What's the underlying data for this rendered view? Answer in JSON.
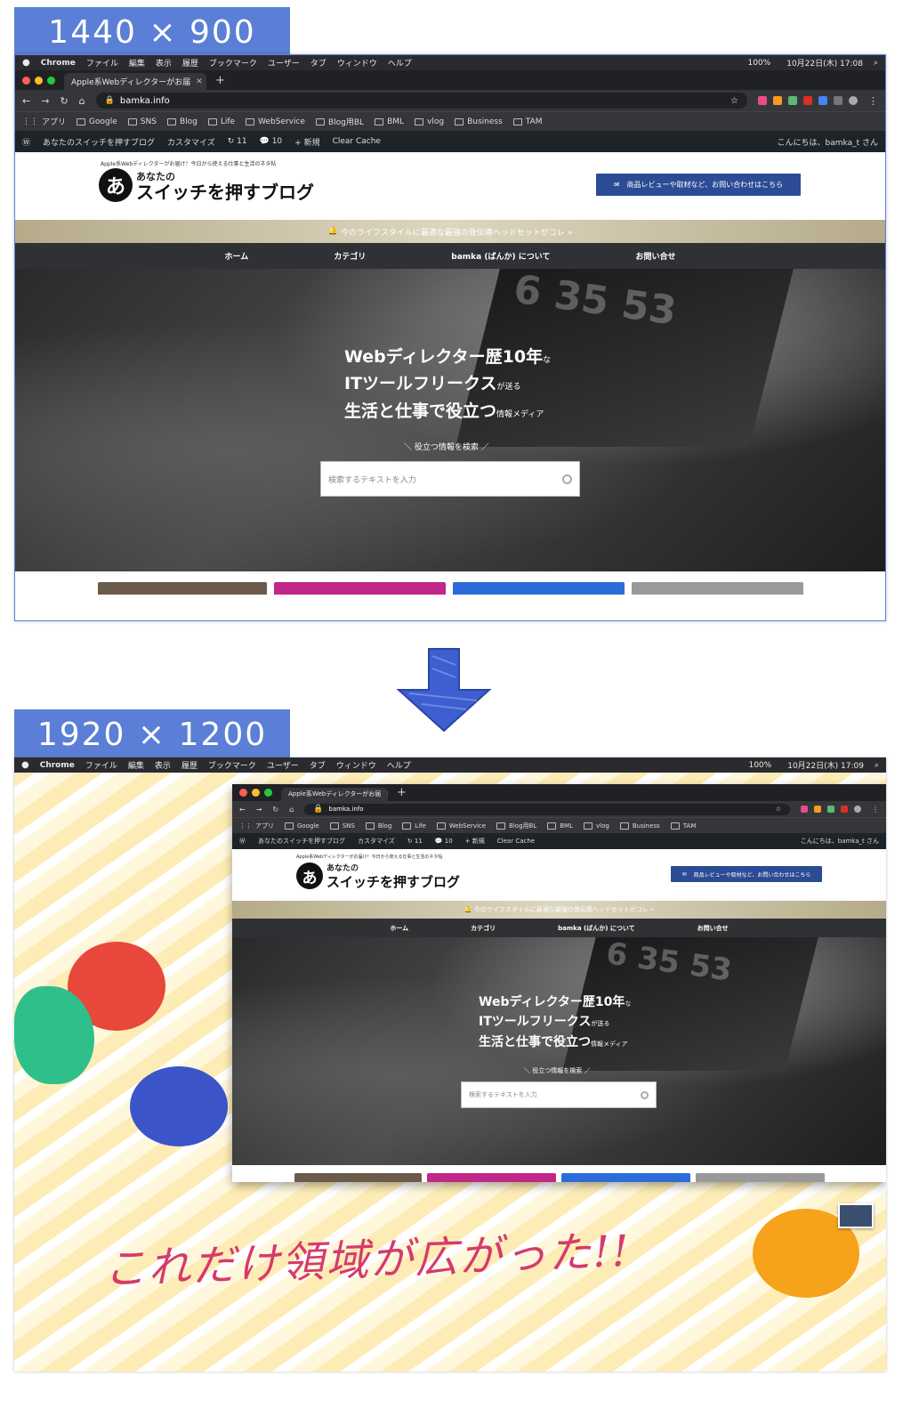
{
  "labels": {
    "top": "1440 × 900",
    "bottom": "1920 × 1200"
  },
  "menubar": {
    "app": "Chrome",
    "items": [
      "ファイル",
      "編集",
      "表示",
      "履歴",
      "ブックマーク",
      "ユーザー",
      "タブ",
      "ウィンドウ",
      "ヘルプ"
    ],
    "battery": "100%",
    "clock_top": "10月22日(木) 17:08",
    "clock_bottom": "10月22日(木) 17:09"
  },
  "browser": {
    "tab_title": "Apple系Webディレクターがお届",
    "url": "bamka.info",
    "bookmarks": [
      "アプリ",
      "Google",
      "SNS",
      "Blog",
      "Life",
      "WebService",
      "Blog用BL",
      "BML",
      "vlog",
      "Business",
      "TAM"
    ]
  },
  "wp_admin": {
    "site_name": "あなたのスイッチを押すブログ",
    "customize": "カスタマイズ",
    "updates": "11",
    "comments": "10",
    "new": "新規",
    "clear_cache": "Clear Cache",
    "greeting": "こんにちは、bamka_t さん"
  },
  "site": {
    "tagline": "Apple系Webディレクターがお届け！今日から使える仕事と生活のネタ帖",
    "logo_mark": "あ",
    "logo_line1": "あなたの",
    "logo_line2": "スイッチを押すブログ",
    "contact_button": "商品レビューや取材など、お問い合わせはこちら",
    "notice": "今のライフスタイルに最適な最強の骨伝導ヘッドセットがコレ »",
    "nav": [
      "ホーム",
      "カテゴリ",
      "bamka (ばんか) について",
      "お問い合せ"
    ],
    "hero": {
      "line1": "Webディレクター歴10年",
      "line1_suffix": "な",
      "line2": "ITツールフリークス",
      "line2_suffix": "が送る",
      "line3": "生活と仕事で役立つ",
      "line3_suffix": "情報メディア",
      "search_heading": "＼ 役立つ情報を検索 ／",
      "search_placeholder": "検索するテキストを入力",
      "deco_number": "6 35 53"
    }
  },
  "caption": "これだけ領域が広がった!!",
  "colors": {
    "label_bg": "#5b7fd6",
    "contact_bg": "#2b4c95",
    "caption": "#d63a6d",
    "arrow": "#3d5fcf"
  }
}
